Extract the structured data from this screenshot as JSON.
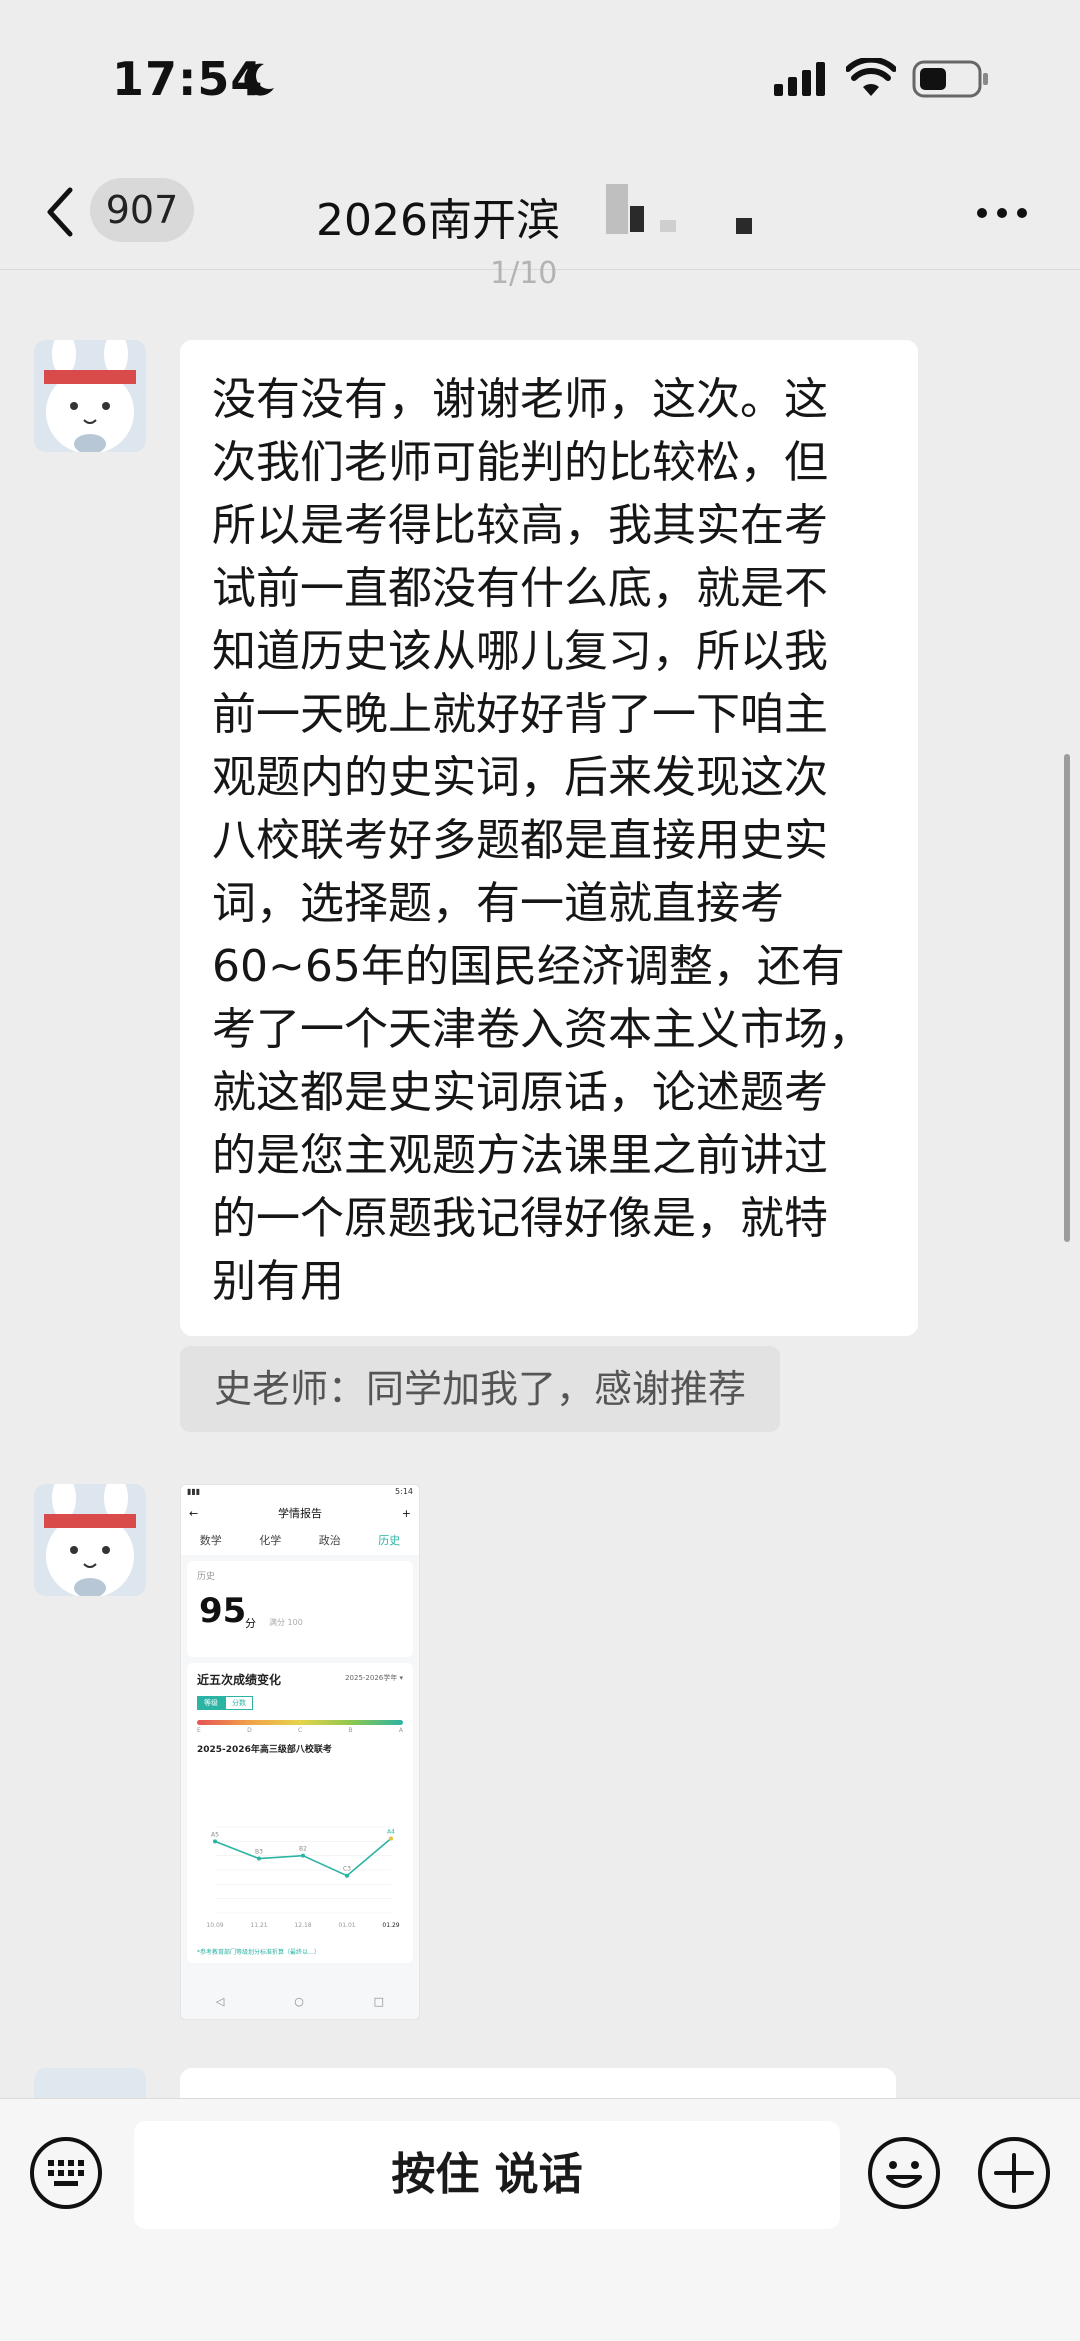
{
  "status_bar": {
    "time": "17:54"
  },
  "header": {
    "unread_count": "907",
    "title": "2026南开滨"
  },
  "date_fragment": "1/10",
  "message_text": {
    "lines": [
      "没有没有，谢谢老师，这次。这",
      "次我们老师可能判的比较松，但",
      "所以是考得比较高，我其实在考",
      "试前一直都没有什么底，就是不",
      "知道历史该从哪儿复习，所以我",
      "前一天晚上就好好背了一下咱主",
      "观题内的史实词，后来发现这次",
      "八校联考好多题都是直接用史实",
      "词，选择题，有一道就直接考",
      "60~65年的国民经济调整，还有",
      "考了一个天津卷入资本主义市场，",
      "就这都是史实词原话，论述题考",
      "的是您主观题方法课里之前讲过",
      "的一个原题我记得好像是，就特",
      "别有用"
    ]
  },
  "system_tip": "史老师：同学加我了，感谢推荐",
  "image_message": {
    "status_time": "5:14",
    "title": "学情报告",
    "tabs": [
      "数学",
      "化学",
      "政治",
      "历史"
    ],
    "active_tab": "历史",
    "subject": "历史",
    "score": "95",
    "score_unit": "分",
    "full_score": "满分 100",
    "trend_title": "近五次成绩变化",
    "year_select": "2025-2026学年 ▾",
    "toggle_on": "等级",
    "toggle_off": "分数",
    "grade_scale": [
      "E",
      "D",
      "C",
      "B",
      "A"
    ],
    "exam_title": "2025-2026年高三级部八校联考",
    "chart_data": {
      "type": "line",
      "x": [
        "10.09",
        "11.21",
        "12.18",
        "01.01",
        "01.29"
      ],
      "grades": [
        "A5",
        "B3",
        "B2",
        "C3",
        "A4"
      ],
      "values": [
        5,
        3.8,
        4,
        2.6,
        5.2
      ]
    },
    "note": "*参考教育部门等级划分标准折算（最终以…）"
  },
  "input_bar": {
    "hold_to_talk": "按住 说话"
  }
}
